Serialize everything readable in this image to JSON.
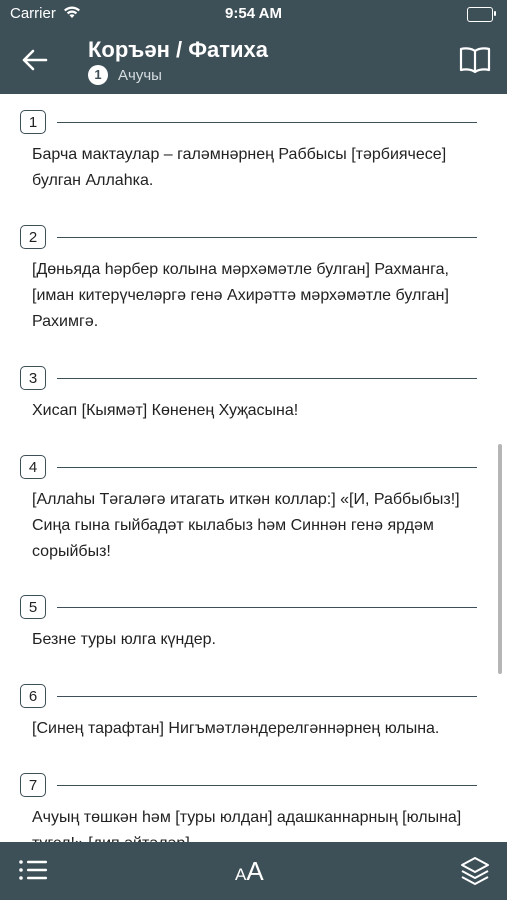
{
  "status_bar": {
    "carrier": "Carrier",
    "time": "9:54 AM"
  },
  "nav": {
    "title": "Коръән / Фатиха",
    "badge": "1",
    "subtitle": "Ачучы"
  },
  "toolbar": {
    "font_small": "A",
    "font_big": "A"
  },
  "verses": [
    {
      "number": "1",
      "text": "Барча мактаулар – галәмнәрнең Раббысы [тәрбиячесе] булган Аллаһка."
    },
    {
      "number": "2",
      "text": "[Дөньяда һәрбер колына мәрхәмәтле булган] Рахманга, [иман китерүчеләргә генә Ахирәттә мәрхәмәтле булган] Рахимгә."
    },
    {
      "number": "3",
      "text": "Хисап [Кыямәт] Көненең Хуҗасына!"
    },
    {
      "number": "4",
      "text": "[Аллаһы Тәгаләгә итагать иткән коллар:] «[И, Раббыбыз!] Сиңа гына гыйбадәт кылабыз һәм Синнән генә ярдәм сорыйбыз!"
    },
    {
      "number": "5",
      "text": "Безне туры юлга күндер."
    },
    {
      "number": "6",
      "text": "[Синең тарафтан] Нигъмәтләндерелгәннәрнең юлына."
    },
    {
      "number": "7",
      "text": "Ачуың төшкән һәм [туры юлдан] адашканнарның [юлына] түгел!» [дип әйтәләр]."
    }
  ]
}
